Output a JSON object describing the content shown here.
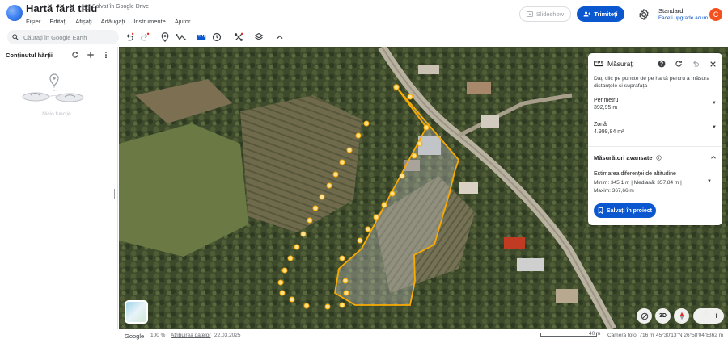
{
  "app": {
    "title": "Hartă fără titlu",
    "drive_status": "Salvat în Google Drive"
  },
  "menu": [
    "Fișier",
    "Editați",
    "Afișați",
    "Adăugați",
    "Instrumente",
    "Ajutor"
  ],
  "header": {
    "slideshow_label": "Slideshow",
    "share_label": "Trimiteți",
    "plan_label": "Standard",
    "upgrade_label": "Faceți upgrade acum",
    "avatar_letter": "C"
  },
  "search": {
    "placeholder": "Căutați în Google Earth"
  },
  "left_panel": {
    "title": "Conținutul hărții",
    "empty_text": "Nicio funcție"
  },
  "measure": {
    "title": "Măsurați",
    "hint": "Dați clic pe puncte de pe hartă pentru a măsura distanțele și suprafața",
    "perimeter_label": "Perimetru",
    "perimeter_value": "392,95 m",
    "area_label": "Zonă",
    "area_value": "4.999,84 m²",
    "advanced_label": "Măsurători avansate",
    "elevation_title": "Estimarea diferenței de altitudine",
    "elevation_line1": "Minim: 345,1 m | Mediană: 357,84 m |",
    "elevation_line2": "Maxim: 367,66 m",
    "save_label": "Salvați în proiect"
  },
  "map_controls": {
    "tilt_label": "3D"
  },
  "status_bar": {
    "google": "Google",
    "zoom": "100 %",
    "attribution": "Atribuirea datelor",
    "date": "22.03.2025",
    "scale": "40 m",
    "camera": "Cameră foto: 716 m",
    "coords": "45°30'13\"N 26°58'04\"E",
    "elevation": "362 m"
  },
  "colors": {
    "accent": "#0b57d0",
    "polygon": "#f9ab00",
    "avatar": "#f4511e"
  }
}
